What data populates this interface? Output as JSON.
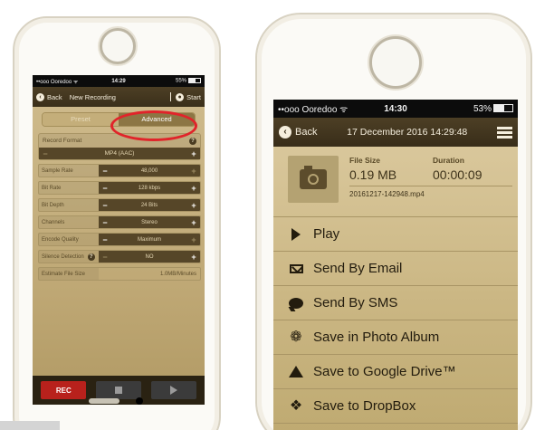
{
  "left_screen": {
    "status": {
      "carrier": "••ooo Ooredoo ᯤ",
      "time": "14:29",
      "battery": "55%"
    },
    "nav": {
      "back_label": "Back",
      "title": "New Recording",
      "action_label": "Start"
    },
    "tabs": [
      {
        "label": "Preset",
        "selected": false
      },
      {
        "label": "Advanced",
        "selected": true
      }
    ],
    "record_format": {
      "label": "Record Format",
      "value": "MP4 (AAC)"
    },
    "settings": [
      {
        "label": "Sample Rate",
        "value": "48,000"
      },
      {
        "label": "Bit Rate",
        "value": "128 kbps"
      },
      {
        "label": "Bit Depth",
        "value": "24 Bits"
      },
      {
        "label": "Channels",
        "value": "Stereo"
      },
      {
        "label": "Encode Quality",
        "value": "Maximum"
      },
      {
        "label": "Silence Detection",
        "value": "NO"
      }
    ],
    "estimate": {
      "label": "Estimate File Size",
      "value": "1.0MB/Minutes"
    },
    "footer": {
      "rec_label": "REC"
    },
    "highlight_color": "#e0242a"
  },
  "right_screen": {
    "status": {
      "carrier": "••ooo Ooredoo ᯤ",
      "time": "14:30",
      "battery": "53%"
    },
    "nav": {
      "back_label": "Back",
      "title": "17 December 2016 14:29:48"
    },
    "info": {
      "size_label": "File Size",
      "size_value": "0.19 MB",
      "duration_label": "Duration",
      "duration_value": "00:00:09",
      "filename": "20161217-142948.mp4"
    },
    "actions": [
      {
        "label": "Play",
        "icon": "play-icon"
      },
      {
        "label": "Send By Email",
        "icon": "email-icon"
      },
      {
        "label": "Send By SMS",
        "icon": "sms-bubble-icon"
      },
      {
        "label": "Save in Photo Album",
        "icon": "photo-album-icon"
      },
      {
        "label": "Save to Google Drive™",
        "icon": "google-drive-icon"
      },
      {
        "label": "Save to DropBox",
        "icon": "dropbox-icon"
      }
    ]
  }
}
